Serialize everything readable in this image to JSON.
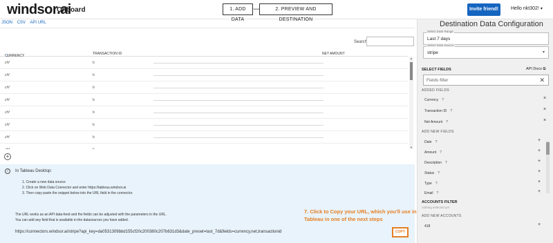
{
  "app": {
    "logo": "windsor.ai",
    "section": "Onboard"
  },
  "steps": [
    {
      "label": "1. ADD DATA"
    },
    {
      "label": "2. PREVIEW AND DESTINATION"
    }
  ],
  "step_arrow": "⟶",
  "header": {
    "invite_label": "Invite friend!",
    "greeting": "Hello nkt302!"
  },
  "tabs": [
    "JSON",
    "CSV",
    "API URL"
  ],
  "table": {
    "search_label": "Search",
    "columns": [
      "CURRENCY",
      "TRANSACTION ID",
      "NET AMOUNT"
    ],
    "rows": [
      {
        "currency": "chf",
        "id": "b"
      },
      {
        "currency": "chf",
        "id": "b"
      },
      {
        "currency": "chf",
        "id": "b"
      },
      {
        "currency": "chf",
        "id": "b"
      },
      {
        "currency": "chf",
        "id": "b"
      },
      {
        "currency": "chf",
        "id": "b"
      },
      {
        "currency": "chf",
        "id": "b"
      },
      {
        "currency": "chf",
        "id": "b"
      }
    ]
  },
  "info": {
    "title": "In Tableau Desktop:",
    "steps": [
      "1. Create a new data source",
      "2. Click on Web Data Connector and enter https://tableau.windsor.ai",
      "3. Then copy paste the snippet below into the URL field in the connector."
    ],
    "note_1": "The URL works as an API data-feed and the fields can be adjusted with the parameters in the URL.",
    "note_2": "You can add any field that is available in the datasources you have added.",
    "url": "https://connectors.windsor.ai/stripe?api_key=da0531309bbd155cf20c200380c207b631d3&date_preset=last_7d&fields=currency,net,transactionid",
    "copy_label": "COPY",
    "callout": "7. Click to Copy your URL, which you'll use in Tableau in one of the next steps"
  },
  "config": {
    "title": "Destination Data Configuration",
    "date_range_legend": "Select Date Range",
    "date_range_value": "Last 7 days",
    "data_source_legend": "Select Data Source",
    "data_source_value": "stripe",
    "select_fields_label": "SELECT FIELDS",
    "api_docs_label": "API Docs",
    "fields_filter_placeholder": "Fields filter",
    "added_fields_label": "ADDED FIELDS",
    "added_fields": [
      "Currency",
      "Transaction ID",
      "Net Amount"
    ],
    "add_new_fields_label": "ADD NEW FIELDS",
    "new_fields": [
      "Date",
      "Amount",
      "Description",
      "Status",
      "Type",
      "Email"
    ],
    "accounts_filter_label": "ACCOUNTS FILTER",
    "nothing_selected": "nothing selected yet",
    "add_new_accounts_label": "ADD NEW ACCOUNTS",
    "account_value": "418"
  },
  "colors": {
    "accent": "#1565c0",
    "callout": "#e67e22",
    "info_bg": "#e8f3fb"
  }
}
